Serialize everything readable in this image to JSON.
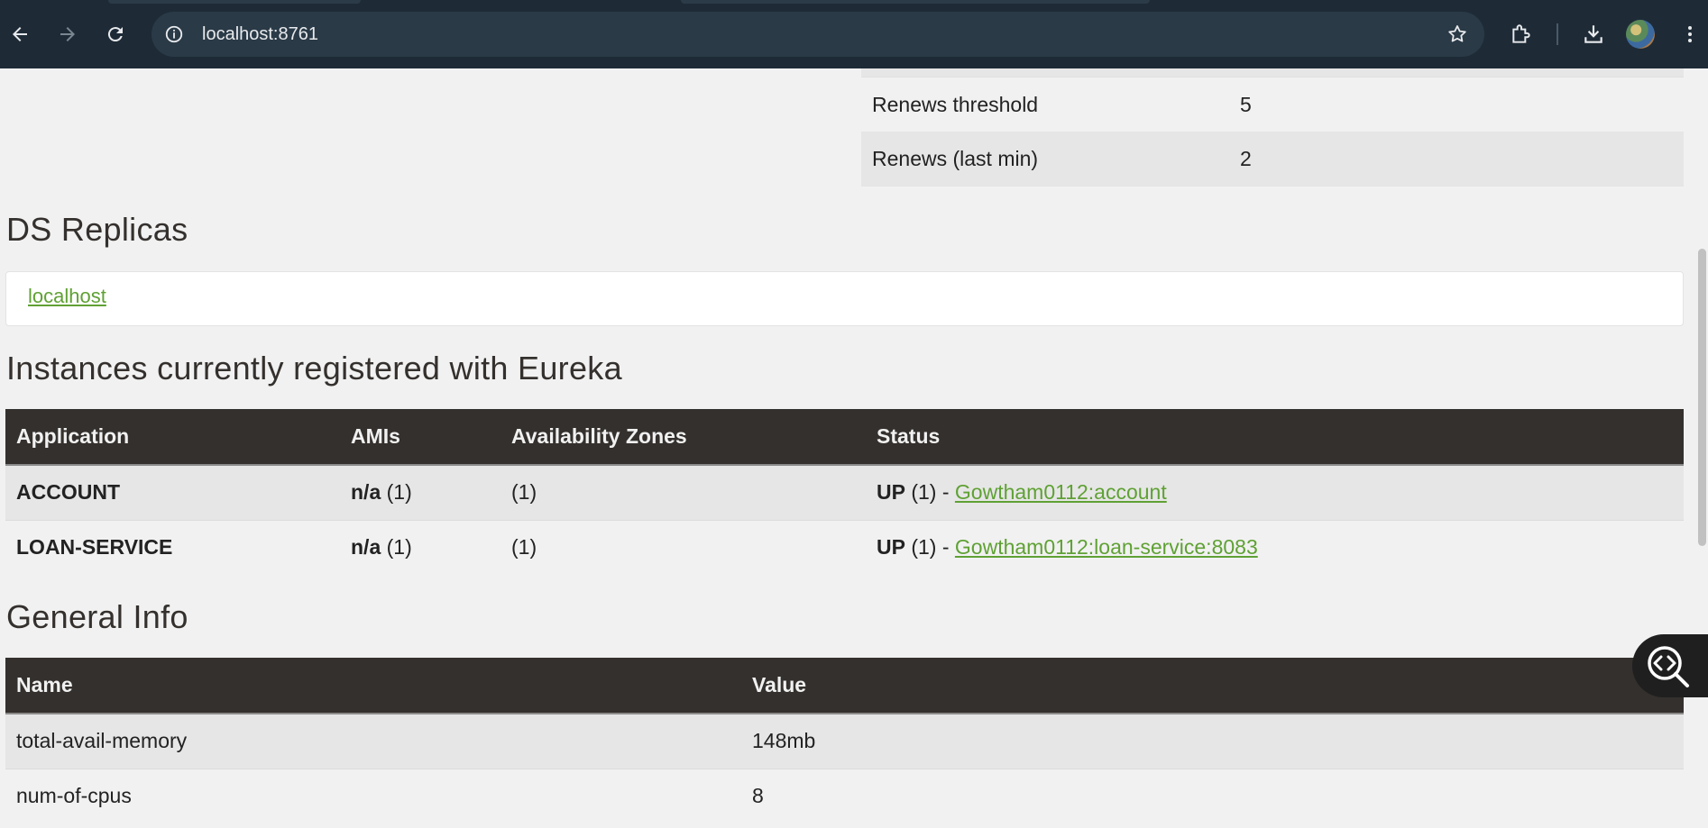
{
  "browser": {
    "url": "localhost:8761",
    "icons": [
      "back-icon",
      "forward-icon",
      "reload-icon",
      "site-info-icon",
      "bookmark-star-icon",
      "extensions-icon",
      "downloads-icon",
      "profile-avatar",
      "menu-icon"
    ]
  },
  "lease_info": {
    "rows": [
      {
        "label": "Renews threshold",
        "value": "5"
      },
      {
        "label": "Renews (last min)",
        "value": "2"
      }
    ]
  },
  "ds_replicas": {
    "title": "DS Replicas",
    "link": "localhost"
  },
  "instances": {
    "title": "Instances currently registered with Eureka",
    "headers": [
      "Application",
      "AMIs",
      "Availability Zones",
      "Status"
    ],
    "rows": [
      {
        "application": "ACCOUNT",
        "ami": "n/a",
        "ami_count": " (1)",
        "zones": "(1)",
        "status": "UP",
        "status_count": " (1) - ",
        "instance_link": "Gowtham0112:account"
      },
      {
        "application": "LOAN-SERVICE",
        "ami": "n/a",
        "ami_count": " (1)",
        "zones": "(1)",
        "status": "UP",
        "status_count": " (1) - ",
        "instance_link": "Gowtham0112:loan-service:8083"
      }
    ]
  },
  "general_info": {
    "title": "General Info",
    "headers": [
      "Name",
      "Value"
    ],
    "rows": [
      {
        "name": "total-avail-memory",
        "value": "148mb"
      },
      {
        "name": "num-of-cpus",
        "value": "8"
      }
    ]
  }
}
